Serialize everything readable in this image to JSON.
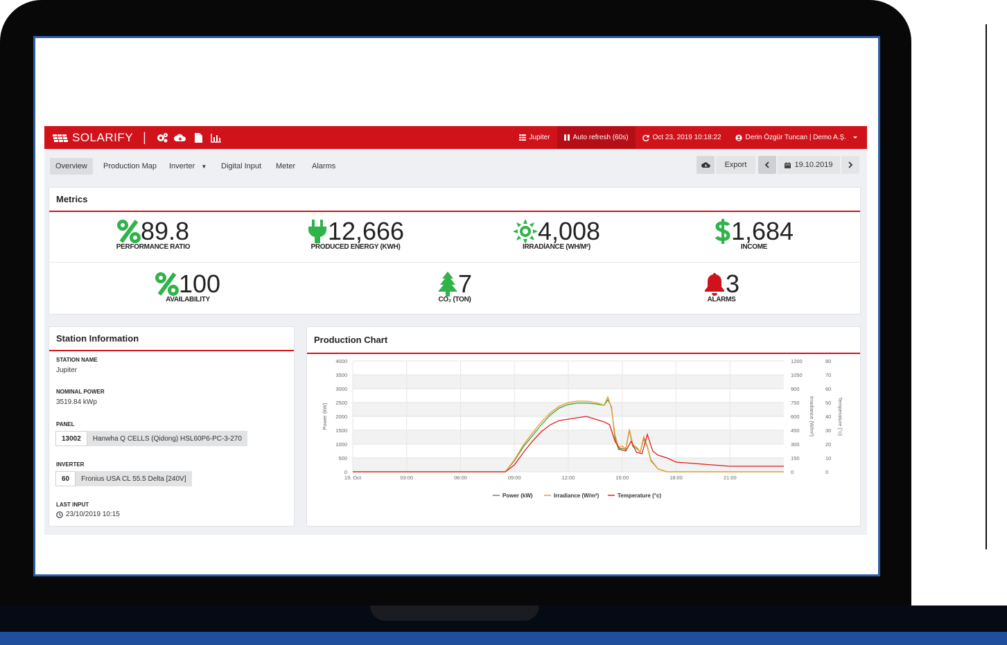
{
  "app": {
    "brand": "SOLARIFY",
    "brand_sep": "|",
    "toolbar_icons": [
      "gears-icon",
      "cloud-icon",
      "file-icon",
      "bar-chart-icon"
    ]
  },
  "topbar": {
    "station": "Jupiter",
    "auto_refresh": "Auto refresh (60s)",
    "last_refresh": "Oct 23, 2019 10:18:22",
    "user": "Derin Özgür Tuncan | Demo A.Ş."
  },
  "nav": {
    "items": [
      "Overview",
      "Production Map",
      "Inverter",
      "Digital Input",
      "Meter",
      "Alarms"
    ],
    "export": "Export",
    "date": "19.10.2019"
  },
  "metrics": {
    "title": "Metrics",
    "items": [
      {
        "value": "89.8",
        "label": "PERFORMANCE RATIO",
        "icon": "percent-icon",
        "color": "#2fb34a"
      },
      {
        "value": "12,666",
        "label": "PRODUCED ENERGY (KWH)",
        "icon": "plug-icon",
        "color": "#2fb34a"
      },
      {
        "value": "4,008",
        "label": "IRRADİANCE (WH/M²)",
        "icon": "sun-icon",
        "color": "#2fb34a"
      },
      {
        "value": "1,684",
        "label": "INCOME",
        "icon": "dollar-icon",
        "color": "#2fb34a"
      },
      {
        "value": "100",
        "label": "AVAILABILITY",
        "icon": "percent-icon",
        "color": "#2fb34a"
      },
      {
        "value": "7",
        "label": "CO₂ (TON)",
        "icon": "tree-icon",
        "color": "#2fb34a"
      },
      {
        "value": "3",
        "label": "ALARMS",
        "icon": "bell-icon",
        "color": "#d0121b"
      }
    ]
  },
  "station": {
    "title": "Station Information",
    "name_label": "STATION NAME",
    "name": "Jupiter",
    "power_label": "NOMINAL POWER",
    "power": "3519.84 kWp",
    "panel_label": "PANEL",
    "panel_count": "13002",
    "panel_model": "Hanwha Q CELLS (Qidong) HSL60P6-PC-3-270",
    "inverter_label": "INVERTER",
    "inverter_count": "60",
    "inverter_model": "Fronius USA CL 55.5 Delta [240V]",
    "last_input_label": "LAST INPUT",
    "last_input": "23/10/2019 10:15"
  },
  "chart_title": "Production Chart",
  "chart_data": {
    "type": "line",
    "x_ticks": [
      "19. Oct",
      "03:00",
      "06:00",
      "09:00",
      "12:00",
      "15:00",
      "18:00",
      "21:00"
    ],
    "xlim": [
      0,
      24
    ],
    "y_left": {
      "label": "Power (kW)",
      "ticks": [
        0,
        500,
        1000,
        1500,
        2000,
        2500,
        3000,
        3500,
        4000
      ],
      "range": [
        0,
        4000
      ]
    },
    "y_right1": {
      "label": "Irradiance (W/m²)",
      "ticks": [
        0,
        150,
        300,
        450,
        600,
        750,
        900,
        1050,
        1200
      ],
      "range": [
        0,
        1200
      ]
    },
    "y_right2": {
      "label": "Temperature (°c)",
      "ticks": [
        0,
        10,
        20,
        30,
        40,
        50,
        60,
        70,
        80
      ],
      "range": [
        0,
        80
      ]
    },
    "series": [
      {
        "name": "Power (kW)",
        "color": "#3aa63a",
        "axis": "left",
        "x": [
          0,
          8.5,
          9,
          9.5,
          10,
          10.5,
          11,
          11.5,
          12,
          12.5,
          13,
          13.5,
          14,
          14.2,
          14.4,
          14.6,
          14.8,
          15,
          15.2,
          15.4,
          15.6,
          15.8,
          16,
          16.2,
          16.4,
          16.6,
          17,
          17.5,
          24
        ],
        "y": [
          0,
          0,
          400,
          900,
          1300,
          1700,
          2050,
          2300,
          2430,
          2480,
          2480,
          2450,
          2400,
          2600,
          2350,
          1200,
          800,
          850,
          800,
          1500,
          900,
          850,
          700,
          1200,
          900,
          400,
          100,
          0,
          0
        ]
      },
      {
        "name": "Irradiance (W/m²)",
        "color": "#f0962b",
        "axis": "right1",
        "x": [
          0,
          8.5,
          9,
          9.5,
          10,
          10.5,
          11,
          11.5,
          12,
          12.5,
          13,
          13.5,
          14,
          14.2,
          14.4,
          14.6,
          14.8,
          15,
          15.2,
          15.4,
          15.6,
          15.8,
          16,
          16.2,
          16.4,
          16.6,
          17,
          17.5,
          24
        ],
        "y": [
          0,
          0,
          130,
          290,
          420,
          540,
          640,
          710,
          750,
          765,
          765,
          750,
          720,
          810,
          690,
          400,
          260,
          280,
          250,
          460,
          290,
          270,
          210,
          380,
          280,
          130,
          30,
          0,
          0
        ]
      },
      {
        "name": "Temperature (°c)",
        "color": "#e31b1b",
        "axis": "right2",
        "x": [
          0,
          8.5,
          9,
          9.5,
          10,
          10.5,
          11,
          11.5,
          12,
          12.5,
          13,
          13.5,
          14,
          14.3,
          14.6,
          14.9,
          15.2,
          15.5,
          15.8,
          16.1,
          16.4,
          16.7,
          17,
          17.5,
          18,
          19,
          20,
          21,
          22,
          23,
          24
        ],
        "y": [
          0,
          0,
          5,
          14,
          22,
          29,
          34,
          37,
          38,
          39,
          40,
          38,
          36,
          34,
          22,
          16,
          15,
          22,
          14,
          13,
          27,
          15,
          12,
          10,
          7,
          6,
          5,
          4,
          4,
          4,
          4
        ]
      }
    ],
    "legend": "bottom"
  }
}
